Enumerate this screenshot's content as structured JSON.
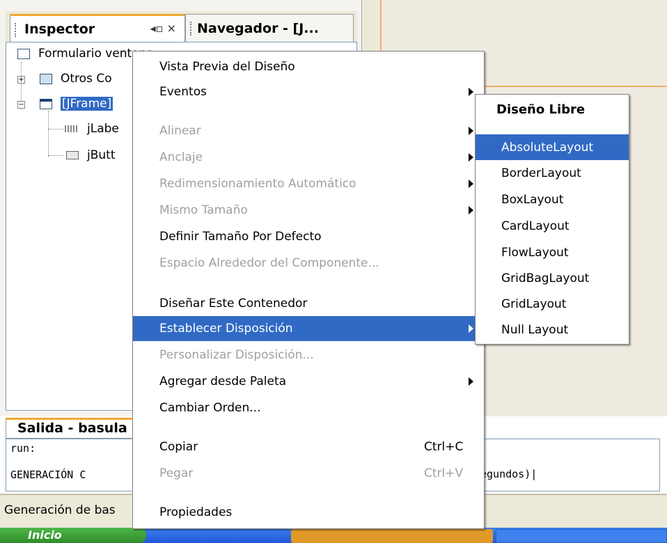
{
  "inspector": {
    "tab_label": "Inspector",
    "tab_controls": "◂▫ ×",
    "navigator_tab_label": "Navegador - [J...",
    "tree": [
      {
        "label": "Formulario ventana"
      },
      {
        "label": "Otros Co"
      },
      {
        "label": "[JFrame]"
      },
      {
        "label": "jLabe"
      },
      {
        "label": "jButt"
      }
    ]
  },
  "context_menu": {
    "items": [
      {
        "label": "Vista Previa del Diseño",
        "enabled": true
      },
      {
        "label": "Eventos",
        "enabled": true,
        "submenu": true
      },
      {
        "label": "Alinear",
        "enabled": false,
        "submenu": true
      },
      {
        "label": "Anclaje",
        "enabled": false,
        "submenu": true
      },
      {
        "label": "Redimensionamiento Automático",
        "enabled": false,
        "submenu": true
      },
      {
        "label": "Mismo Tamaño",
        "enabled": false,
        "submenu": true
      },
      {
        "label": "Definir Tamaño Por Defecto",
        "enabled": true
      },
      {
        "label": "Espacio Alrededor del Componente...",
        "enabled": false
      },
      {
        "label": "Diseñar Este Contenedor",
        "enabled": true
      },
      {
        "label": "Establecer Disposición",
        "enabled": true,
        "submenu": true,
        "highlighted": true
      },
      {
        "label": "Personalizar Disposición...",
        "enabled": false
      },
      {
        "label": "Agregar desde Paleta",
        "enabled": true,
        "submenu": true
      },
      {
        "label": "Cambiar Orden...",
        "enabled": true
      },
      {
        "label": "Copiar",
        "shortcut": "Ctrl+C",
        "enabled": true
      },
      {
        "label": "Pegar",
        "shortcut": "Ctrl+V",
        "enabled": false
      },
      {
        "label": "Propiedades",
        "enabled": true
      }
    ]
  },
  "layout_submenu": {
    "header": "Diseño Libre",
    "items": [
      {
        "label": "AbsoluteLayout",
        "highlighted": true
      },
      {
        "label": "BorderLayout"
      },
      {
        "label": "BoxLayout"
      },
      {
        "label": "CardLayout"
      },
      {
        "label": "FlowLayout"
      },
      {
        "label": "GridBagLayout"
      },
      {
        "label": "GridLayout"
      },
      {
        "label": "Null Layout"
      }
    ]
  },
  "output": {
    "tab_label": "Salida - basula",
    "line1": "run:",
    "line2_start": "GENERACIÓN C",
    "line2_end": "egundos)|"
  },
  "status": {
    "text": "Generación de bas"
  },
  "taskbar": {
    "start_label": "Inicio"
  },
  "colors": {
    "selection": "#316ac5",
    "disabled_text": "#a0a0a0",
    "tab_accent": "#f1a832"
  }
}
